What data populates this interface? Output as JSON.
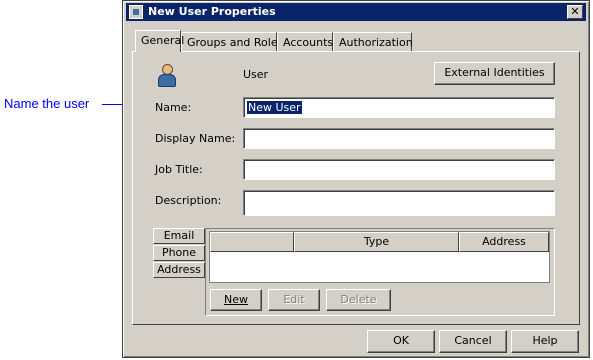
{
  "callout": {
    "text": "Name the user"
  },
  "window": {
    "title": "New User Properties",
    "close_glyph": "✕",
    "icon": "app-icon"
  },
  "tabs": [
    {
      "label": "General",
      "active": true
    },
    {
      "label": "Groups and Roles",
      "active": false
    },
    {
      "label": "Accounts",
      "active": false
    },
    {
      "label": "Authorization",
      "active": false
    }
  ],
  "general": {
    "user_label": "User",
    "user_icon": "user-icon",
    "external_identities_label": "External Identities",
    "fields": {
      "name": {
        "label": "Name:",
        "value": "New User"
      },
      "display_name": {
        "label": "Display Name:",
        "value": ""
      },
      "job_title": {
        "label": "Job Title:",
        "value": ""
      },
      "description": {
        "label": "Description:",
        "value": ""
      }
    },
    "contact_tabs": [
      "Email",
      "Phone",
      "Address"
    ],
    "columns": [
      "",
      "Type",
      "Address"
    ],
    "buttons": {
      "new": "New",
      "edit": "Edit",
      "delete": "Delete"
    }
  },
  "footer": {
    "ok": "OK",
    "cancel": "Cancel",
    "help": "Help"
  }
}
